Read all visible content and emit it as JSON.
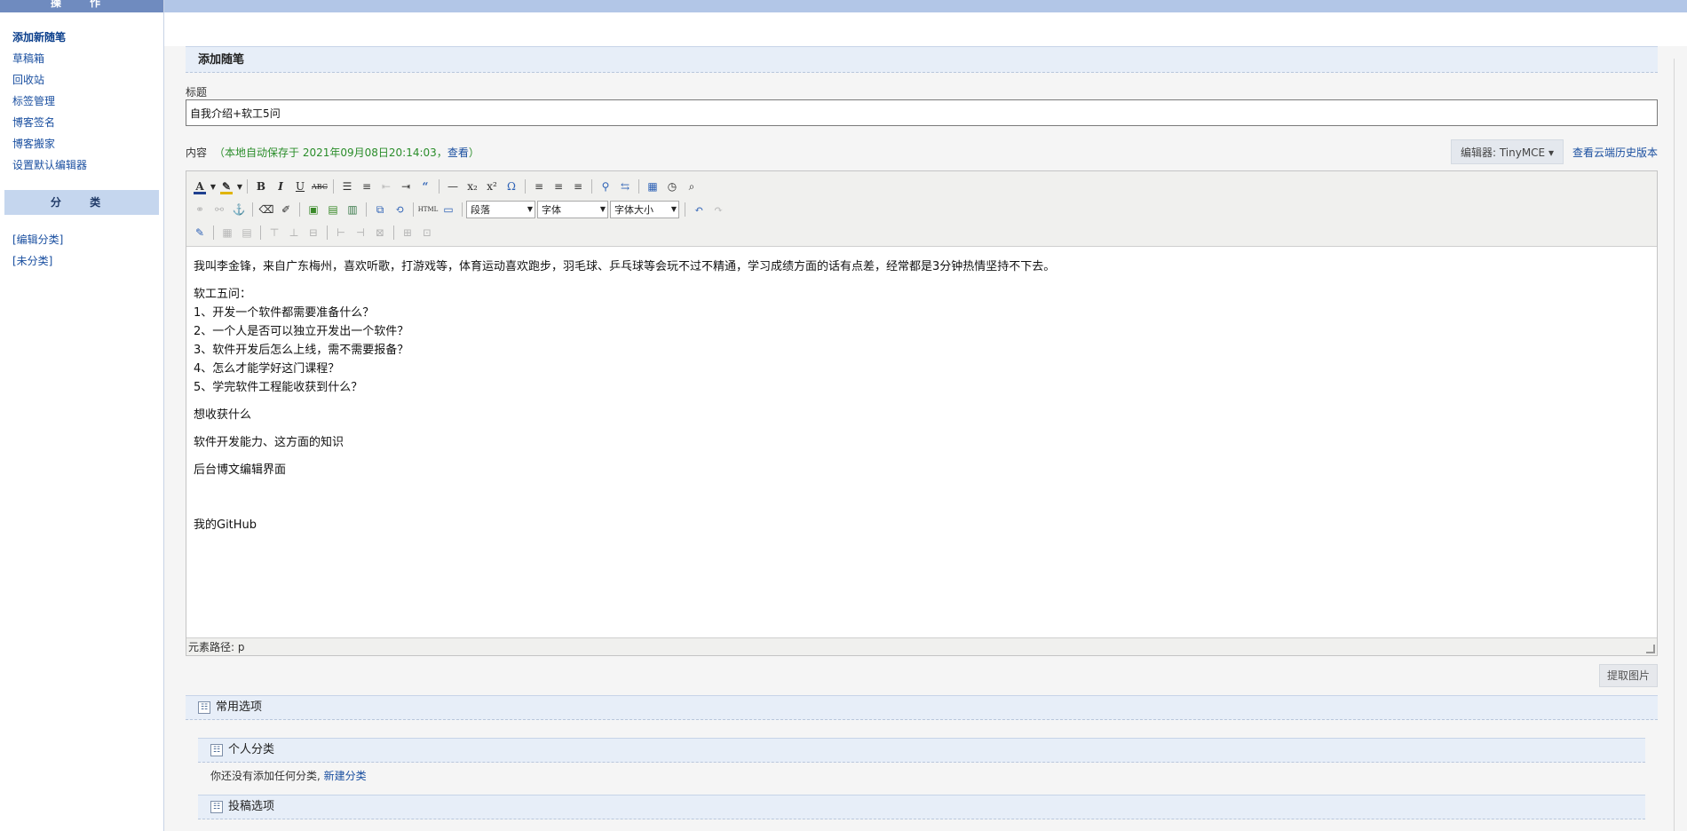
{
  "sidebar": {
    "header": "操 作",
    "links": [
      {
        "label": "添加新随笔",
        "current": true
      },
      {
        "label": "草稿箱"
      },
      {
        "label": "回收站"
      },
      {
        "label": "标签管理"
      },
      {
        "label": "博客签名"
      },
      {
        "label": "博客搬家"
      },
      {
        "label": "设置默认编辑器"
      }
    ],
    "category_header": "分 类",
    "category_links": [
      {
        "label": "[编辑分类]"
      },
      {
        "label": "[未分类]"
      }
    ]
  },
  "page": {
    "section_title": "添加随笔",
    "title_label": "标题",
    "title_value": "自我介绍+软工5问",
    "content_label": "内容",
    "autosave_prefix": "（本地自动保存于 2021年09月08日20:14:03，",
    "autosave_link": "查看",
    "autosave_suffix": "）",
    "editor_select": "编辑器: TinyMCE ▾",
    "history_link": "查看云端历史版本"
  },
  "toolbar": {
    "paragraph_select": "段落",
    "font_select": "字体",
    "size_select": "字体大小",
    "html_label": "HTML"
  },
  "content": {
    "intro": "我叫李金锋，来自广东梅州，喜欢听歌，打游戏等，体育运动喜欢跑步，羽毛球、乒乓球等会玩不过不精通，学习成绩方面的话有点差，经常都是3分钟热情坚持不下去。",
    "five_q_title": "软工五问：",
    "q1": "1、开发一个软件都需要准备什么？",
    "q2": "2、一个人是否可以独立开发出一个软件？",
    "q3": "3、软件开发后怎么上线，需不需要报备？",
    "q4": "4、怎么才能学好这门课程？",
    "q5": "5、学完软件工程能收获到什么？",
    "p_want": "想收获什么",
    "p_skill": "软件开发能力、这方面的知识",
    "p_backend": "后台博文编辑界面",
    "p_github": "我的GitHub"
  },
  "statusbar": {
    "path": "元素路径: p"
  },
  "fetch_image": "提取图片",
  "options": {
    "common": "常用选项",
    "personal_category": "个人分类",
    "no_category_note": "你还没有添加任何分类, ",
    "new_category_link": "新建分类",
    "submit_options": "投稿选项"
  }
}
